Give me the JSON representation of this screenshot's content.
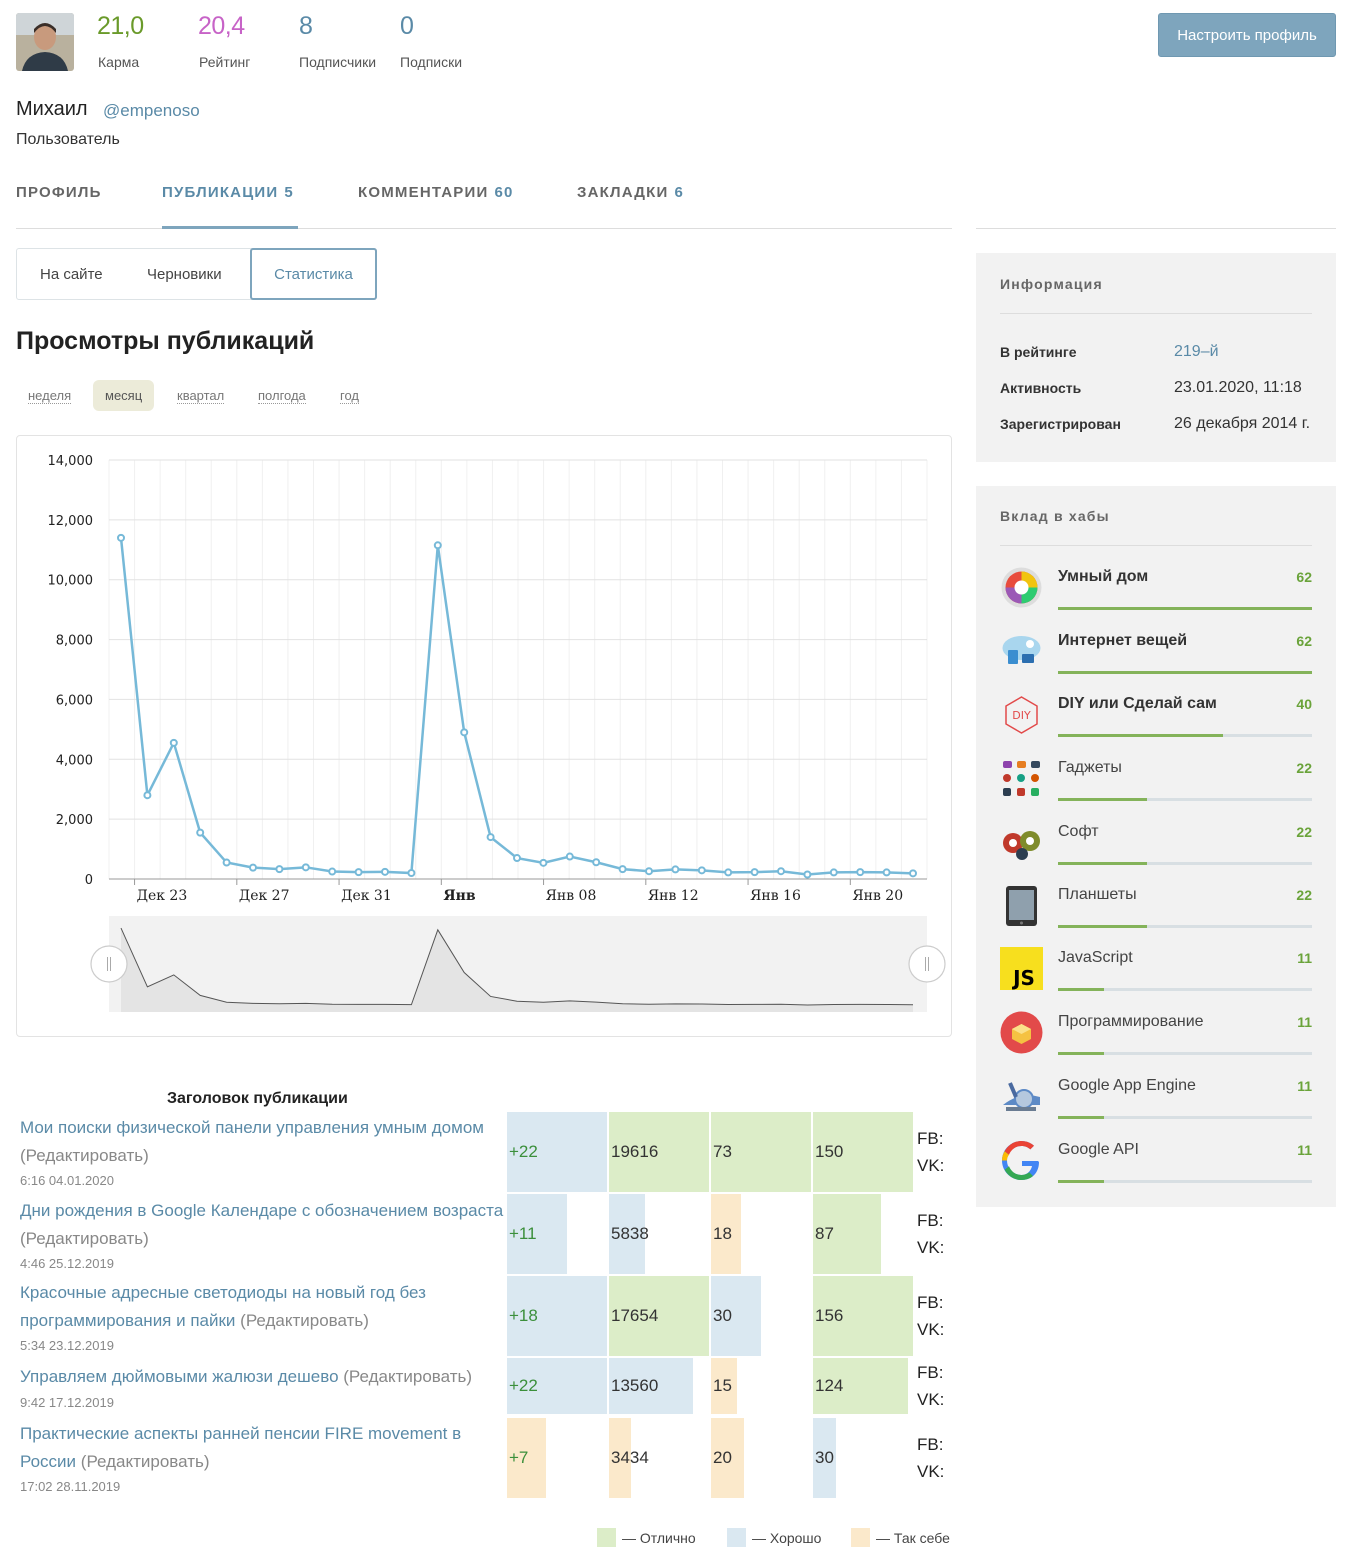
{
  "profile": {
    "stats": [
      {
        "value": "21,0",
        "label": "Карма",
        "color": "#6a9a2a"
      },
      {
        "value": "20,4",
        "label": "Рейтинг",
        "color": "#c763c7"
      },
      {
        "value": "8",
        "label": "Подписчики",
        "color": "#5a8aa7"
      },
      {
        "value": "0",
        "label": "Подписки",
        "color": "#5a8aa7"
      }
    ],
    "settings_button": "Настроить профиль",
    "name": "Михаил",
    "nick": "@empenoso",
    "role": "Пользователь"
  },
  "tabs": [
    {
      "label": "Профиль",
      "count": ""
    },
    {
      "label": "Публикации",
      "count": "5"
    },
    {
      "label": "Комментарии",
      "count": "60"
    },
    {
      "label": "Закладки",
      "count": "6"
    }
  ],
  "subtabs": [
    "На сайте",
    "Черновики",
    "Статистика"
  ],
  "stats_title": "Просмотры публикаций",
  "periods": [
    "неделя",
    "месяц",
    "квартал",
    "полгода",
    "год"
  ],
  "chart_data": {
    "type": "line",
    "x": [
      "Дек 22",
      "Дек 23",
      "Дек 24",
      "Дек 25",
      "Дек 26",
      "Дек 27",
      "Дек 28",
      "Дек 29",
      "Дек 30",
      "Дек 31",
      "Янв 01",
      "Янв 02",
      "Янв 03",
      "Янв 04",
      "Янв 05",
      "Янв 06",
      "Янв 07",
      "Янв 08",
      "Янв 09",
      "Янв 10",
      "Янв 11",
      "Янв 12",
      "Янв 13",
      "Янв 14",
      "Янв 15",
      "Янв 16",
      "Янв 17",
      "Янв 18",
      "Янв 19",
      "Янв 20",
      "Янв 21",
      "Янв 22"
    ],
    "series": [
      {
        "values": [
          11400,
          2800,
          4550,
          1550,
          550,
          380,
          330,
          390,
          250,
          230,
          240,
          200,
          11150,
          4900,
          1400,
          700,
          540,
          750,
          560,
          330,
          260,
          320,
          290,
          220,
          230,
          260,
          150,
          220,
          230,
          220,
          190
        ]
      }
    ],
    "x_tick_labels": [
      "Дек 23",
      "Дек 27",
      "Дек 31",
      "Янв",
      "Янв 08",
      "Янв 12",
      "Янв 16",
      "Янв 20"
    ],
    "y_ticks": [
      "0",
      "2,000",
      "4,000",
      "6,000",
      "8,000",
      "10,000",
      "12,000",
      "14,000"
    ],
    "ylim": [
      0,
      14000
    ],
    "line_color": "#76b9d8",
    "grid": true
  },
  "table": {
    "header": "Заголовок публикации",
    "edit_label": "(Редактировать)",
    "rows": [
      {
        "title": "Мои поиски физической панели управления умным домом",
        "date": "6:16 04.01.2020",
        "rating": "+22",
        "views": "19616",
        "bookmarks": "73",
        "comments": "150"
      },
      {
        "title": "Дни рождения в Google Календаре с обозначением возраста",
        "date": "4:46 25.12.2019",
        "rating": "+11",
        "views": "5838",
        "bookmarks": "18",
        "comments": "87"
      },
      {
        "title": "Красочные адресные светодиоды на новый год без программирования и пайки",
        "date": "5:34 23.12.2019",
        "rating": "+18",
        "views": "17654",
        "bookmarks": "30",
        "comments": "156"
      },
      {
        "title": "Управляем дюймовыми жалюзи дешево",
        "date": "9:42 17.12.2019",
        "rating": "+22",
        "views": "13560",
        "bookmarks": "15",
        "comments": "124"
      },
      {
        "title": "Практические аспекты ранней пенсии FIRE movement в России",
        "date": "17:02 28.11.2019",
        "rating": "+7",
        "views": "3434",
        "bookmarks": "20",
        "comments": "30"
      }
    ],
    "social": {
      "fb": "FB:",
      "vk": "VK:"
    },
    "legend": [
      {
        "label": "— Отлично",
        "color": "#dcedc8"
      },
      {
        "label": "— Хорошо",
        "color": "#dae8f1"
      },
      {
        "label": "— Так себе",
        "color": "#fbe9cb"
      }
    ]
  },
  "info": {
    "title": "Информация",
    "items": [
      {
        "label": "В рейтинге",
        "value": "219–й"
      },
      {
        "label": "Активность",
        "value": "23.01.2020, 11:18"
      },
      {
        "label": "Зарегистрирован",
        "value": "26 декабря 2014 г."
      }
    ]
  },
  "hubs": {
    "title": "Вклад в хабы",
    "items": [
      {
        "name": "Умный дом",
        "score": "62",
        "fraction": 1.0
      },
      {
        "name": "Интернет вещей",
        "score": "62",
        "fraction": 1.0
      },
      {
        "name": "DIY или Сделай сам",
        "score": "40",
        "fraction": 0.65
      },
      {
        "name": "Гаджеты",
        "score": "22",
        "fraction": 0.35
      },
      {
        "name": "Софт",
        "score": "22",
        "fraction": 0.35
      },
      {
        "name": "Планшеты",
        "score": "22",
        "fraction": 0.35
      },
      {
        "name": "JavaScript",
        "score": "11",
        "fraction": 0.18
      },
      {
        "name": "Программирование",
        "score": "11",
        "fraction": 0.18
      },
      {
        "name": "Google App Engine",
        "score": "11",
        "fraction": 0.18
      },
      {
        "name": "Google API",
        "score": "11",
        "fraction": 0.18
      }
    ]
  }
}
